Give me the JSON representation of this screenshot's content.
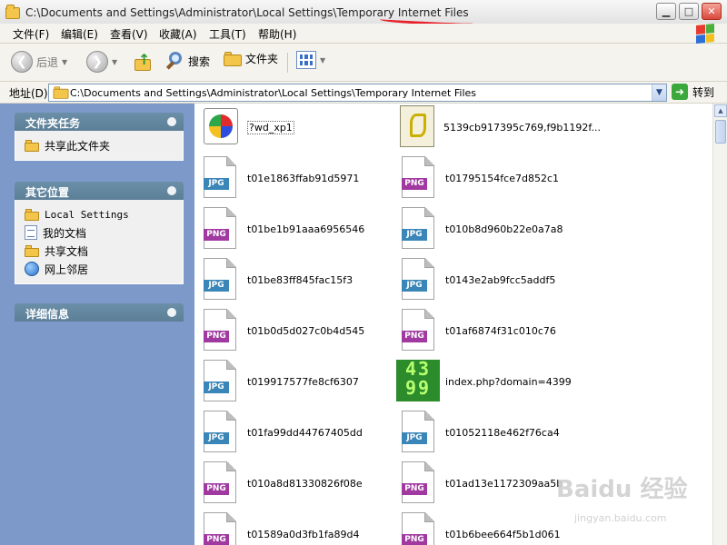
{
  "window": {
    "title": "C:\\Documents and Settings\\Administrator\\Local Settings\\Temporary Internet Files",
    "controls": {
      "minimize": "▁",
      "maximize": "□",
      "close": "✕"
    }
  },
  "menubar": {
    "items": [
      "文件(F)",
      "编辑(E)",
      "查看(V)",
      "收藏(A)",
      "工具(T)",
      "帮助(H)"
    ]
  },
  "toolbar": {
    "back_label": "后退",
    "forward_icon": "forward-arrow",
    "search_label": "搜索",
    "folders_label": "文件夹"
  },
  "address": {
    "label": "地址(D)",
    "value": "C:\\Documents and Settings\\Administrator\\Local Settings\\Temporary Internet Files",
    "go_label": "转到"
  },
  "taskpane": {
    "file_tasks": {
      "title": "文件夹任务",
      "items": [
        "共享此文件夹"
      ]
    },
    "other_places": {
      "title": "其它位置",
      "items": [
        "Local Settings",
        "我的文档",
        "共享文档",
        "网上邻居"
      ]
    },
    "details": {
      "title": "详细信息"
    }
  },
  "files": [
    {
      "name": "?wd_xp1",
      "type": "exe"
    },
    {
      "name": "5139cb917395c769,f9b1192f...",
      "type": "script"
    },
    {
      "name": "t01e1863ffab91d5971",
      "type": "JPG"
    },
    {
      "name": "t01795154fce7d852c1",
      "type": "PNG"
    },
    {
      "name": "t01be1b91aaa6956546",
      "type": "PNG"
    },
    {
      "name": "t010b8d960b22e0a7a8",
      "type": "JPG"
    },
    {
      "name": "t01be83ff845fac15f3",
      "type": "JPG"
    },
    {
      "name": "t0143e2ab9fcc5addf5",
      "type": "JPG"
    },
    {
      "name": "t01b0d5d027c0b4d545",
      "type": "PNG"
    },
    {
      "name": "t01af6874f31c010c76",
      "type": "PNG"
    },
    {
      "name": "t019917577fe8cf6307",
      "type": "JPG"
    },
    {
      "name": "index.php?domain=4399",
      "type": "4399",
      "logo_text": "43 99"
    },
    {
      "name": "t01fa99dd44767405dd",
      "type": "JPG"
    },
    {
      "name": "t01052118e462f76ca4",
      "type": "JPG"
    },
    {
      "name": "t010a8d81330826f08e",
      "type": "PNG"
    },
    {
      "name": "t01ad13e1172309aa5b",
      "type": "PNG"
    },
    {
      "name": "t01589a0d3fb1fa89d4",
      "type": "PNG"
    },
    {
      "name": "t01b6bee664f5b1d061",
      "type": "PNG"
    }
  ],
  "watermark": {
    "brand": "Baidu 经验",
    "url": "jingyan.baidu.com"
  },
  "colors": {
    "title_underline": "#e8202a",
    "jpg_badge": "#3a86b8",
    "png_badge": "#a03aa0",
    "taskpane_bg": "#7c99c9"
  }
}
